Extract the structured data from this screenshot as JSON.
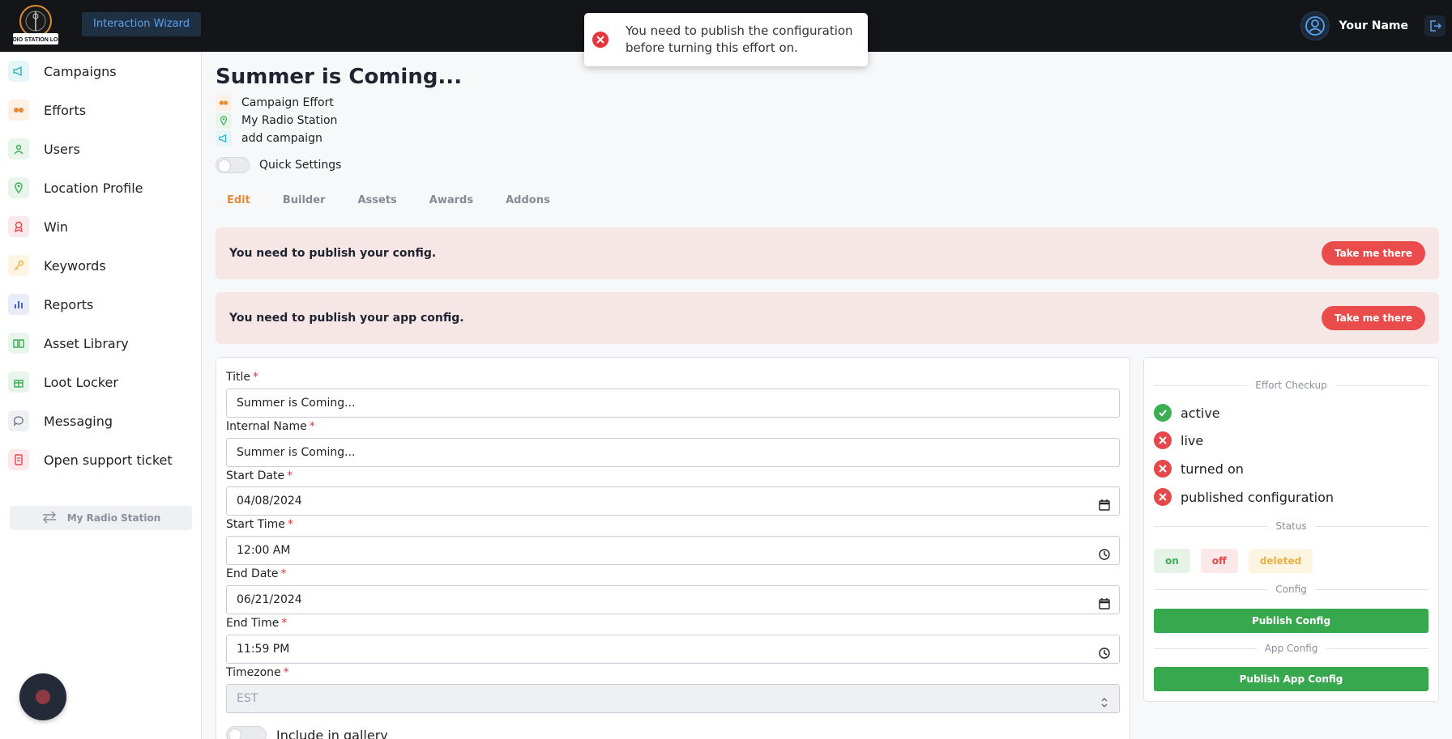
{
  "topbar": {
    "logo_text": "RADIO STATION LOGO",
    "wizard_label": "Interaction Wizard",
    "user_name": "Your Name"
  },
  "toast": {
    "message": "You need to publish the configuration before turning this effort on."
  },
  "sidebar": {
    "items": [
      {
        "label": "Campaigns",
        "icon": "megaphone-icon",
        "color": "#2bb3c0"
      },
      {
        "label": "Efforts",
        "icon": "effort-icon",
        "color": "#e88a32"
      },
      {
        "label": "Users",
        "icon": "user-icon",
        "color": "#3cae54"
      },
      {
        "label": "Location Profile",
        "icon": "location-pin-icon",
        "color": "#3cae54"
      },
      {
        "label": "Win",
        "icon": "award-icon",
        "color": "#e5474b"
      },
      {
        "label": "Keywords",
        "icon": "key-icon",
        "color": "#eab04a"
      },
      {
        "label": "Reports",
        "icon": "bar-chart-icon",
        "color": "#4a62c2"
      },
      {
        "label": "Asset Library",
        "icon": "book-icon",
        "color": "#3cae54"
      },
      {
        "label": "Loot Locker",
        "icon": "gift-icon",
        "color": "#3cae54"
      },
      {
        "label": "Messaging",
        "icon": "chat-icon",
        "color": "#6b7280"
      },
      {
        "label": "Open support ticket",
        "icon": "ticket-icon",
        "color": "#e5474b"
      }
    ],
    "station_switch": "My Radio Station"
  },
  "main": {
    "title": "Summer is Coming...",
    "meta": [
      {
        "label": "Campaign Effort",
        "icon": "effort-icon"
      },
      {
        "label": "My Radio Station",
        "icon": "location-pin-icon"
      },
      {
        "label": "add campaign",
        "icon": "megaphone-icon"
      }
    ],
    "quick_settings": "Quick Settings",
    "tabs": [
      "Edit",
      "Builder",
      "Assets",
      "Awards",
      "Addons"
    ],
    "active_tab": "Edit",
    "alerts": [
      {
        "message": "You need to publish your config.",
        "button": "Take me there"
      },
      {
        "message": "You need to publish your app config.",
        "button": "Take me there"
      }
    ]
  },
  "form": {
    "title": {
      "label": "Title",
      "value": "Summer is Coming..."
    },
    "internal_name": {
      "label": "Internal Name",
      "value": "Summer is Coming..."
    },
    "start_date": {
      "label": "Start Date",
      "value": "04/08/2024"
    },
    "start_time": {
      "label": "Start Time",
      "value": "12:00  AM"
    },
    "end_date": {
      "label": "End Date",
      "value": "06/21/2024"
    },
    "end_time": {
      "label": "End Time",
      "value": "11:59  PM"
    },
    "timezone": {
      "label": "Timezone",
      "value": "EST"
    },
    "gallery": {
      "label": "Include in gallery"
    }
  },
  "checkup": {
    "heading": "Effort Checkup",
    "items": [
      {
        "label": "active",
        "ok": true
      },
      {
        "label": "live",
        "ok": false
      },
      {
        "label": "turned on",
        "ok": false
      },
      {
        "label": "published configuration",
        "ok": false
      }
    ],
    "status_heading": "Status",
    "status": {
      "on": "on",
      "off": "off",
      "deleted": "deleted"
    },
    "config_heading": "Config",
    "publish_config": "Publish Config",
    "app_config_heading": "App Config",
    "publish_app_config": "Publish App Config"
  }
}
